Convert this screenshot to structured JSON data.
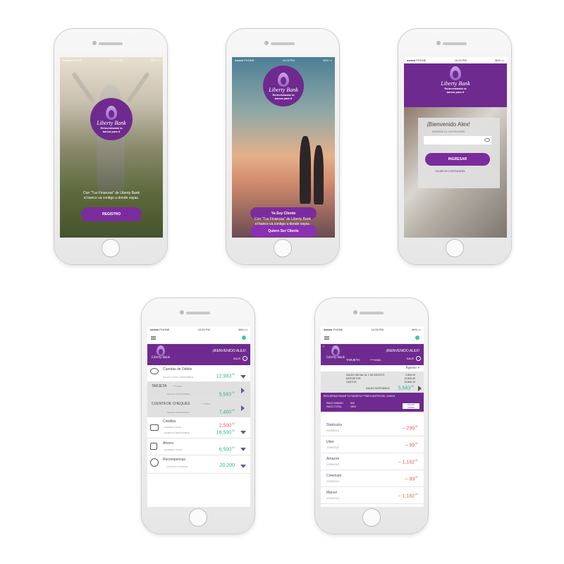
{
  "status": {
    "carrier": "●●●●● PHONE",
    "time": "10:25 PM",
    "battery": "96% ▭"
  },
  "brand": {
    "name": "Liberty Bank",
    "slogan_line1": "Reinventando la",
    "slogan_line2": "banca para ti"
  },
  "screen1": {
    "tagline_line1": "Con \"Tus Finanzas\" de Liberty Bank",
    "tagline_line2": "el banco va contigo a donde vayas.",
    "register_button": "REGISTRO"
  },
  "screen2": {
    "client_button": "Ya Soy Cliente",
    "want_button": "Quiero Ser Cliente",
    "tagline_line1": "Con \"Tus Finanzas\" de Liberty Bank",
    "tagline_line2": "el banco va contigo a donde vayas."
  },
  "screen3": {
    "greeting": "¡Bienvenido Alex!",
    "password_hint": "INGRESA TU CONTRASEÑA",
    "login_button": "INGRESAR",
    "forgot": "OLVIDÉ MI CONTRASEÑA"
  },
  "dashboard": {
    "welcome": "¡BIENVENIDO ALEX!",
    "logout": "SALIR",
    "debit_title": "Cuentas de Débito",
    "debit_sub": "SALDO TOTAL DISPONIBLE",
    "debit_value": "12,983",
    "debit_cents": ".90",
    "card_title": "TARJETA",
    "card_number": "****4563",
    "card_sub": "SALDO DISPONIBLE",
    "card_value": "5,583",
    "card_cents": ".00",
    "checking_title": "CUENTA DE CHEQUES",
    "checking_number": "****4563",
    "checking_sub": "SALDO DISPONIBLE",
    "checking_value": "7,400",
    "checking_cents": ".00",
    "credit_title": "Créditos",
    "credit_sub1": "ADEUDO TOTAL",
    "credit_val1": "2,500",
    "credit_cents1": ".00",
    "credit_sub2": "CRÉDITO DISPONIBLE",
    "credit_val2": "18,500",
    "credit_cents2": ".00",
    "savings_title": "Ahorro",
    "savings_sub": "AHORRO TOTAL",
    "savings_value": "6,500",
    "savings_cents": ".00",
    "rewards_title": "Recompensas",
    "rewards_sub": "PUNTOS TOTALES",
    "rewards_value": "20,200"
  },
  "card_detail": {
    "welcome": "¡BIENVENIDO ALEX!",
    "logout": "SALIR",
    "title": "TARJETA",
    "number": "****4563",
    "month": "Agosto ▾",
    "initial_label": "SALDO INICIAL AL 1 DE AGOSTO",
    "initial_value": "2,890.00",
    "deposits_label": "DEPOSITOS",
    "deposits_value": "13,500.00",
    "expenses_label": "GASTOS",
    "expenses_value": "10,806.10",
    "available_label": "SALDO DISPONIBLE",
    "available_value": "5,583",
    "available_cents": ".00",
    "reminder": "RECUERDA PAGAR TU TARJETA ****5674 ANTES DEL 1/09/18",
    "min_label": "PAGO MINIMO",
    "min_value": "500",
    "total_label": "PAGO TOTAL",
    "total_value": "1500",
    "pay_button_line1": "PAGAR",
    "pay_button_line2": "AHORA",
    "transactions": [
      {
        "name": "Starbucks",
        "date": "23/08/2018",
        "amount": "– 299",
        "cents": ".00"
      },
      {
        "name": "Uber",
        "date": "22/08/2018",
        "amount": "– 99",
        "cents": ".00"
      },
      {
        "name": "Amazon",
        "date": "22/08/2018",
        "amount": "– 1,182",
        "cents": ".00"
      },
      {
        "name": "Cinemark",
        "date": "22/08/2018",
        "amount": "– 99",
        "cents": ".00"
      },
      {
        "name": "Marvel",
        "date": "22/08/2018",
        "amount": "– 1,182",
        "cents": ".00"
      }
    ]
  },
  "colors": {
    "brand_purple": "#6e2a8e",
    "button_purple": "#7b2c9c",
    "positive_green": "#2bb58f",
    "negative_red": "#e75b5b"
  }
}
